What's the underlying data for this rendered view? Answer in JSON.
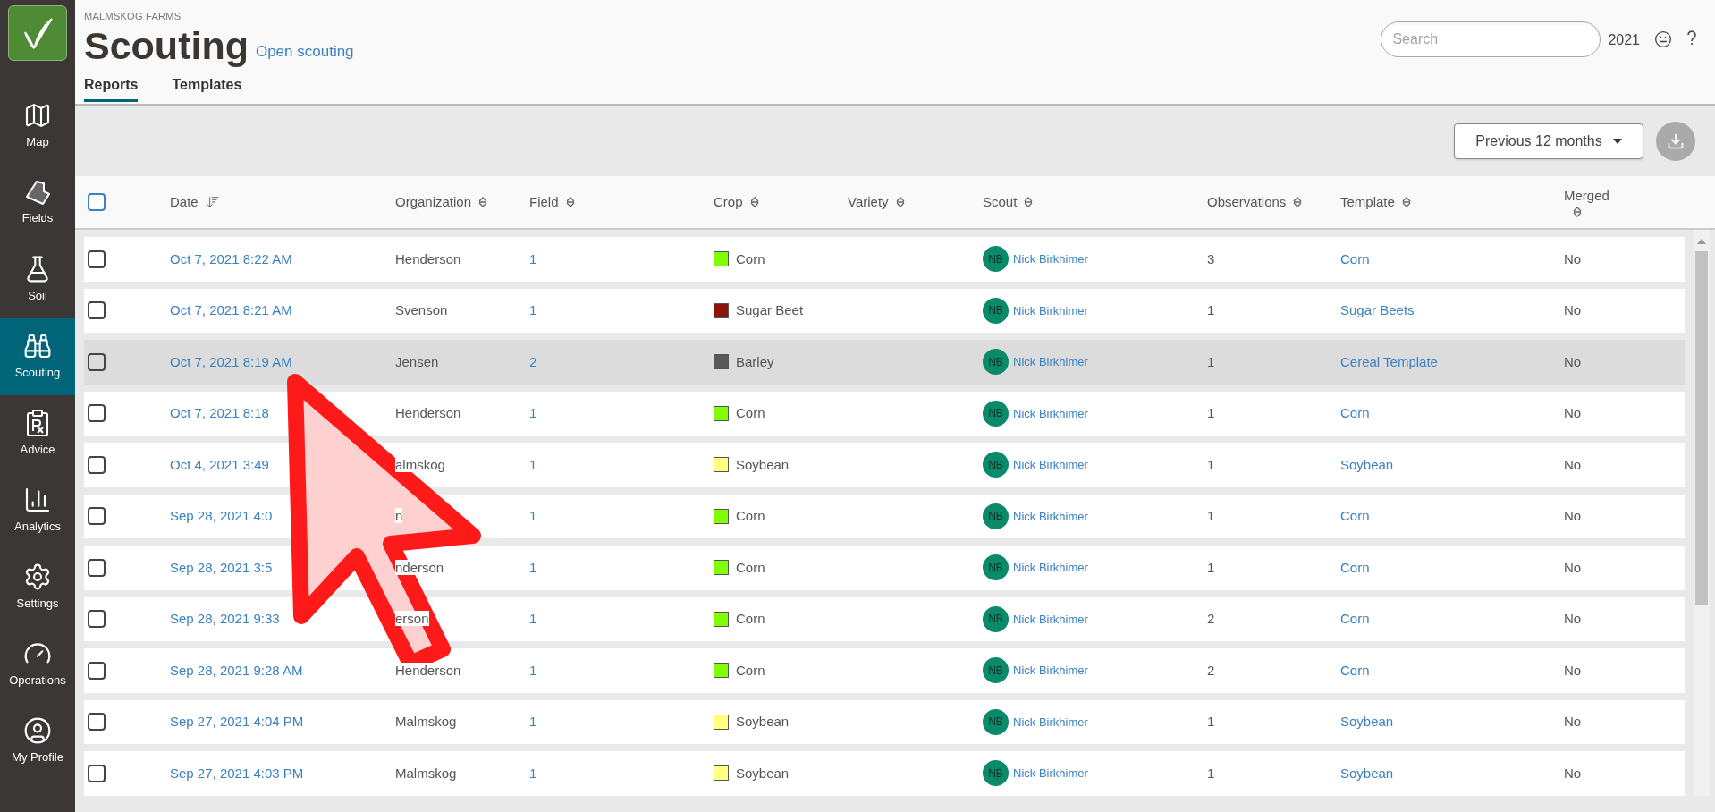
{
  "sidebar": {
    "items": [
      {
        "label": "Map",
        "kind": "map",
        "selected": false
      },
      {
        "label": "Fields",
        "kind": "fields",
        "selected": false
      },
      {
        "label": "Soil",
        "kind": "soil",
        "selected": false
      },
      {
        "label": "Scouting",
        "kind": "scouting",
        "selected": true
      },
      {
        "label": "Advice",
        "kind": "advice",
        "selected": false
      },
      {
        "label": "Analytics",
        "kind": "analytics",
        "selected": false
      },
      {
        "label": "Settings",
        "kind": "settings",
        "selected": false
      },
      {
        "label": "Operations",
        "kind": "operations",
        "selected": false
      },
      {
        "label": "My Profile",
        "kind": "profile",
        "selected": false
      }
    ]
  },
  "header": {
    "farm": "MALMSKOG FARMS",
    "title": "Scouting",
    "link": "Open scouting",
    "search": {
      "placeholder": "Search"
    },
    "year": "2021"
  },
  "tabs": [
    {
      "label": "Reports",
      "selected": true
    },
    {
      "label": "Templates",
      "selected": false
    }
  ],
  "toolbar": {
    "period": "Previous 12 months"
  },
  "table": {
    "select_all": {
      "checked": false
    },
    "columns": [
      "Date",
      "Organization",
      "Field",
      "Crop",
      "Variety",
      "Scout",
      "Observations",
      "Template",
      "Merged"
    ],
    "rows": [
      {
        "checked": false,
        "highlighted": false,
        "date": "Oct 7, 2021 8:22 AM",
        "organization": "Henderson",
        "field": "1",
        "crop": "Corn",
        "color": "#80ff00",
        "initials": "NB",
        "scout": "Nick Birkhimer",
        "observations": "3",
        "template": "Corn",
        "merged": "No"
      },
      {
        "checked": false,
        "highlighted": false,
        "date": "Oct 7, 2021 8:21 AM",
        "organization": "Svenson",
        "field": "1",
        "crop": "Sugar Beet",
        "color": "#8b1309",
        "initials": "NB",
        "scout": "Nick Birkhimer",
        "observations": "1",
        "template": "Sugar Beets",
        "merged": "No"
      },
      {
        "checked": false,
        "highlighted": true,
        "date": "Oct 7, 2021 8:19 AM",
        "organization": "Jensen",
        "field": "2",
        "crop": "Barley",
        "color": "#595959",
        "initials": "NB",
        "scout": "Nick Birkhimer",
        "observations": "1",
        "template": "Cereal Template",
        "merged": "No"
      },
      {
        "checked": false,
        "highlighted": false,
        "date": "Oct 7, 2021 8:18",
        "organization": "Henderson",
        "field": "1",
        "crop": "Corn",
        "color": "#80ff00",
        "initials": "NB",
        "scout": "Nick Birkhimer",
        "observations": "1",
        "template": "Corn",
        "merged": "No"
      },
      {
        "checked": false,
        "highlighted": false,
        "date": "Oct 4, 2021 3:49",
        "organization": "almskog",
        "field": "1",
        "crop": "Soybean",
        "color": "#ffff80",
        "initials": "NB",
        "scout": "Nick Birkhimer",
        "observations": "1",
        "template": "Soybean",
        "merged": "No"
      },
      {
        "checked": false,
        "highlighted": false,
        "date": "Sep 28, 2021 4:0",
        "organization": "n",
        "field": "1",
        "crop": "Corn",
        "color": "#80ff00",
        "initials": "NB",
        "scout": "Nick Birkhimer",
        "observations": "1",
        "template": "Corn",
        "merged": "No"
      },
      {
        "checked": false,
        "highlighted": false,
        "date": "Sep 28, 2021 3:5",
        "organization": "nderson",
        "field": "1",
        "crop": "Corn",
        "color": "#80ff00",
        "initials": "NB",
        "scout": "Nick Birkhimer",
        "observations": "1",
        "template": "Corn",
        "merged": "No"
      },
      {
        "checked": false,
        "highlighted": false,
        "date": "Sep 28, 2021 9:33",
        "organization": "erson",
        "field": "1",
        "crop": "Corn",
        "color": "#80ff00",
        "initials": "NB",
        "scout": "Nick Birkhimer",
        "observations": "2",
        "template": "Corn",
        "merged": "No"
      },
      {
        "checked": false,
        "highlighted": false,
        "date": "Sep 28, 2021 9:28 AM",
        "organization": "Henderson",
        "field": "1",
        "crop": "Corn",
        "color": "#80ff00",
        "initials": "NB",
        "scout": "Nick Birkhimer",
        "observations": "2",
        "template": "Corn",
        "merged": "No"
      },
      {
        "checked": false,
        "highlighted": false,
        "date": "Sep 27, 2021 4:04 PM",
        "organization": "Malmskog",
        "field": "1",
        "crop": "Soybean",
        "color": "#ffff80",
        "initials": "NB",
        "scout": "Nick Birkhimer",
        "observations": "1",
        "template": "Soybean",
        "merged": "No"
      },
      {
        "checked": false,
        "highlighted": false,
        "date": "Sep 27, 2021 4:03 PM",
        "organization": "Malmskog",
        "field": "1",
        "crop": "Soybean",
        "color": "#ffff80",
        "initials": "NB",
        "scout": "Nick Birkhimer",
        "observations": "1",
        "template": "Soybean",
        "merged": "No"
      }
    ]
  }
}
